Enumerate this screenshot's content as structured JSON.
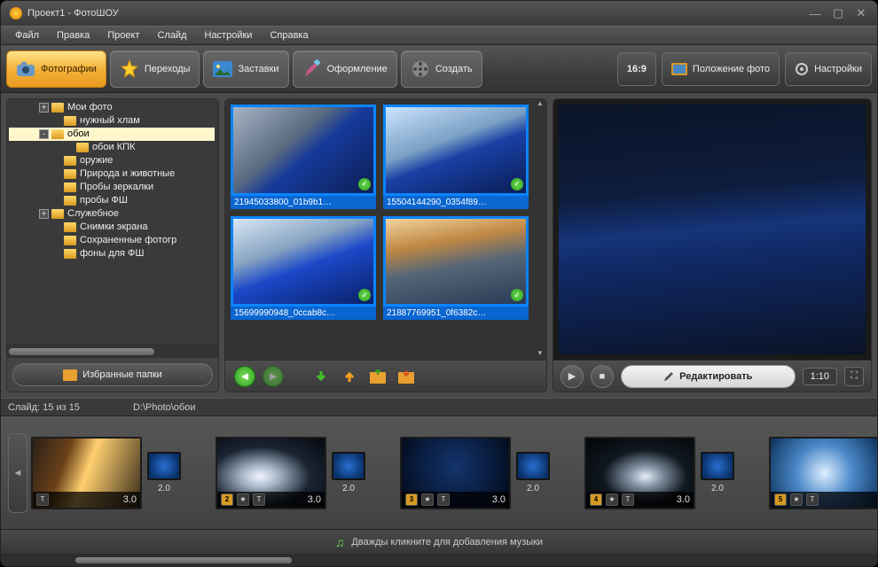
{
  "window": {
    "title": "Проект1 - ФотоШОУ"
  },
  "menu": [
    "Файл",
    "Правка",
    "Проект",
    "Слайд",
    "Настройки",
    "Справка"
  ],
  "tabs": [
    {
      "label": "Фотографии",
      "icon": "camera",
      "active": true
    },
    {
      "label": "Переходы",
      "icon": "star",
      "active": false
    },
    {
      "label": "Заставки",
      "icon": "picture",
      "active": false
    },
    {
      "label": "Оформление",
      "icon": "brush",
      "active": false
    },
    {
      "label": "Создать",
      "icon": "reel",
      "active": false
    }
  ],
  "toolbar_right": {
    "aspect": "16:9",
    "position": "Положение фото",
    "settings": "Настройки"
  },
  "tree": [
    {
      "pad": 34,
      "exp": "+",
      "label": "Мои фото"
    },
    {
      "pad": 48,
      "exp": "",
      "label": "нужный хлам"
    },
    {
      "pad": 34,
      "exp": "-",
      "label": "обои",
      "sel": true
    },
    {
      "pad": 62,
      "exp": "",
      "label": "обои КПК"
    },
    {
      "pad": 48,
      "exp": "",
      "label": "оружие"
    },
    {
      "pad": 48,
      "exp": "",
      "label": "Природа и животные"
    },
    {
      "pad": 48,
      "exp": "",
      "label": "Пробы зеркалки"
    },
    {
      "pad": 48,
      "exp": "",
      "label": "пробы ФШ"
    },
    {
      "pad": 34,
      "exp": "+",
      "label": "Служебное"
    },
    {
      "pad": 48,
      "exp": "",
      "label": "Снимки экрана"
    },
    {
      "pad": 48,
      "exp": "",
      "label": "Сохраненные фотогр"
    },
    {
      "pad": 48,
      "exp": "",
      "label": "фоны для ФШ"
    }
  ],
  "favorites": "Избранные папки",
  "thumbs": [
    {
      "caption": "21945033800_01b9b1…",
      "bg": "linear-gradient(140deg,#a6b4c4 0%,#5a6a80 40%,#163a9a 55%,#0c1e55 100%)"
    },
    {
      "caption": "15504144290_0354f89…",
      "bg": "linear-gradient(160deg,#cbe4ff 0%,#7aa0c4 40%,#1940a5 55%,#0a1d55 100%)"
    },
    {
      "caption": "15699990948_0ccab8c…",
      "bg": "linear-gradient(160deg,#d8e6f5 0%,#88a4c2 35%,#1a48c8 55%,#0b1f66 100%)"
    },
    {
      "caption": "21887769951_0f6382c…",
      "bg": "linear-gradient(170deg,#f0d4a0 0%,#c08844 30%,#556677 55%,#2a3a55 100%)"
    }
  ],
  "preview": {
    "edit": "Редактировать",
    "time": "1:10",
    "bg": "linear-gradient(175deg,#0a1428 0%,#0e1d3d 35%,#15347a 50%,#102a66 60%,#0a1226 100%)"
  },
  "info": {
    "slide": "Слайд: 15 из 15",
    "path": "D:\\Photo\\обои"
  },
  "timeline": [
    {
      "num": "",
      "dur": "3.0",
      "tdur": "2.0",
      "bg": "linear-gradient(110deg,#2a2018 0%,#6a4018 30%,#ffd070 50%,#3a2c1a 100%)"
    },
    {
      "num": "2",
      "dur": "3.0",
      "tdur": "2.0",
      "bg": "radial-gradient(ellipse at 40% 55%,#f2f6ff 0%,#a8b6c8 20%,#1a2432 55%,#050810 100%)"
    },
    {
      "num": "3",
      "dur": "3.0",
      "tdur": "2.0",
      "bg": "radial-gradient(circle at 50% 40%,#13346b 0%,#081a3a 60%,#02060f 100%)"
    },
    {
      "num": "4",
      "dur": "3.0",
      "tdur": "2.0",
      "bg": "radial-gradient(ellipse at 55% 55%,#e8eef6 0%,#8898aa 18%,#101820 50%,#020406 100%)"
    },
    {
      "num": "5",
      "dur": "",
      "tdur": "",
      "bg": "radial-gradient(circle at 50% 50%,#ddeeff 0%,#4a88c8 45%,#0d315a 100%)"
    }
  ],
  "music": "Дважды кликните для добавления музыки"
}
